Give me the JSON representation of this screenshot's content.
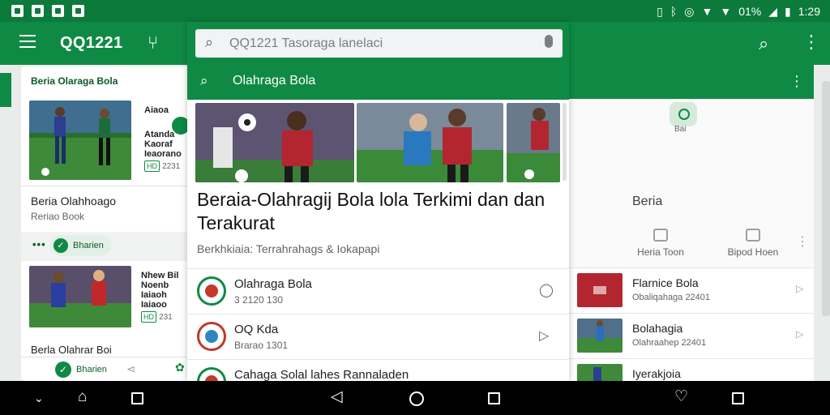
{
  "status_bar": {
    "battery": "01%",
    "time": "1:29"
  },
  "app_bar": {
    "title": "QQ1221"
  },
  "search": {
    "placeholder": "QQ1221 Tasoraga lanelaci",
    "suggestion": "Olahraga Bola"
  },
  "left_card": {
    "category": "Beria Olaraga Bola",
    "item1": {
      "title": "Aiaoa",
      "line1": "Atanda",
      "line2": "Kaoraf",
      "line3": "Ieaorano",
      "tag": "HD",
      "meta": "2231"
    },
    "heading": "Beria Olahhoago",
    "sub": "Reriao Book",
    "pill_label": "Bharien",
    "item2": {
      "title": "Nhew Bil",
      "line1": "Noenb",
      "line2": "Iaiaoh",
      "line3": "Iaiaoo",
      "tag": "HD",
      "meta": "231"
    },
    "heading2": "Berla Olahrar Boi",
    "bottom_label": "Bharien"
  },
  "center": {
    "headline": "Beraia-Olahragij Bola lola Terkimi dan dan Terakurat",
    "meta": "Berkhkiaia:  Terrahrahags & Iokapapi",
    "rows": [
      {
        "title": "Olahraga Bola",
        "subtitle": "3 2120 130"
      },
      {
        "title": "OQ Kda",
        "subtitle": "Brarao 1301"
      },
      {
        "title": "Cahaga Solal lahes Rannaladen",
        "subtitle": ""
      }
    ]
  },
  "right_card": {
    "top_label": "Bai",
    "heading": "Beria",
    "quick_actions": [
      "Heria Toon",
      "Bipod Hoen"
    ],
    "rows": [
      {
        "title": "Flarnice Bola",
        "subtitle": "Obaliqahaga 22401"
      },
      {
        "title": "Bolahagia",
        "subtitle": "Olahraahep 22401"
      },
      {
        "title": "Iyerakjoia",
        "subtitle": ""
      }
    ]
  },
  "colors": {
    "brand": "#0f8a44",
    "brand_dark": "#0c7a3a"
  }
}
